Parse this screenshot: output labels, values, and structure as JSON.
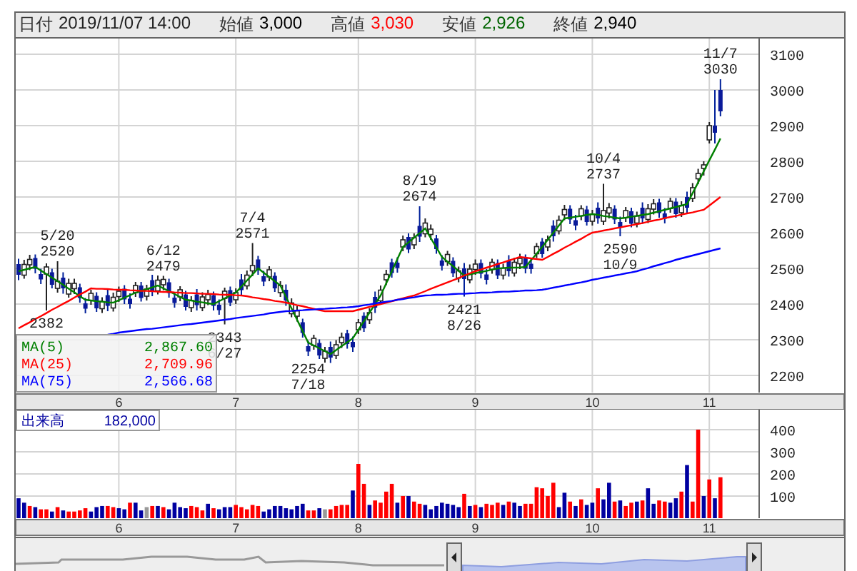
{
  "header": {
    "fields": [
      {
        "label": "日付",
        "value": "2019/11/07 14:00",
        "color": "#222222"
      },
      {
        "label": "始値",
        "value": "3,000",
        "color": "#000000"
      },
      {
        "label": "高値",
        "value": "3,030",
        "color": "#ff0000"
      },
      {
        "label": "安値",
        "value": "2,926",
        "color": "#006400"
      },
      {
        "label": "終値",
        "value": "2,940",
        "color": "#000000"
      }
    ]
  },
  "price_chart": {
    "legend": [
      {
        "value": "2,867.60"
      },
      {
        "value": "2,709.96"
      },
      {
        "value": "2,566.68"
      }
    ],
    "chart_data": {
      "type": "candlestick",
      "grid": true,
      "ylim": [
        2152,
        3144
      ],
      "categories": [
        null,
        null,
        null,
        null,
        null,
        null,
        null,
        null,
        null,
        null,
        null,
        null,
        null,
        null,
        null,
        null,
        null,
        null,
        "6",
        null,
        null,
        null,
        null,
        null,
        null,
        null,
        null,
        null,
        null,
        null,
        null,
        null,
        null,
        null,
        null,
        null,
        null,
        null,
        null,
        "7",
        null,
        null,
        null,
        null,
        null,
        null,
        null,
        null,
        null,
        null,
        null,
        null,
        null,
        null,
        null,
        null,
        null,
        null,
        null,
        null,
        null,
        "8",
        null,
        null,
        null,
        null,
        null,
        null,
        null,
        null,
        null,
        null,
        null,
        null,
        null,
        null,
        null,
        null,
        null,
        null,
        null,
        null,
        "9",
        null,
        null,
        null,
        null,
        null,
        null,
        null,
        null,
        null,
        null,
        null,
        null,
        null,
        null,
        null,
        null,
        null,
        null,
        null,
        null,
        "10",
        null,
        null,
        null,
        null,
        null,
        null,
        null,
        null,
        null,
        null,
        null,
        null,
        null,
        null,
        null,
        null,
        null,
        null,
        null,
        null,
        "11",
        null,
        null
      ],
      "yticks": [
        2200,
        2300,
        2400,
        2500,
        2600,
        2700,
        2800,
        2900,
        3000,
        3100
      ],
      "ohlc": [
        [
          2512,
          2527,
          2467,
          2482
        ],
        [
          2481,
          2524,
          2471,
          2511
        ],
        [
          2510,
          2538,
          2495,
          2525
        ],
        [
          2529,
          2539,
          2486,
          2499
        ],
        [
          2484,
          2499,
          2456,
          2469
        ],
        [
          2484,
          2514,
          2382,
          2504
        ],
        [
          2489,
          2499,
          2444,
          2454
        ],
        [
          2444,
          2520,
          2432,
          2464
        ],
        [
          2474,
          2489,
          2429,
          2444
        ],
        [
          2428,
          2471,
          2418,
          2458
        ],
        [
          2443,
          2471,
          2428,
          2458
        ],
        [
          2447,
          2457,
          2404,
          2417
        ],
        [
          2402,
          2417,
          2374,
          2387
        ],
        [
          2410,
          2440,
          2398,
          2430
        ],
        [
          2423,
          2433,
          2378,
          2388
        ],
        [
          2387,
          2419,
          2375,
          2407
        ],
        [
          2425,
          2440,
          2380,
          2395
        ],
        [
          2389,
          2432,
          2379,
          2419
        ],
        [
          2421,
          2449,
          2406,
          2436
        ],
        [
          2443,
          2453,
          2400,
          2413
        ],
        [
          2415,
          2430,
          2387,
          2400
        ],
        [
          2432,
          2462,
          2420,
          2452
        ],
        [
          2452,
          2462,
          2407,
          2417
        ],
        [
          2422,
          2454,
          2410,
          2442
        ],
        [
          2467,
          2482,
          2422,
          2437
        ],
        [
          2437,
          2480,
          2427,
          2467
        ],
        [
          2454,
          2479,
          2439,
          2469
        ],
        [
          2461,
          2471,
          2418,
          2431
        ],
        [
          2418,
          2433,
          2390,
          2403
        ],
        [
          2420,
          2450,
          2408,
          2440
        ],
        [
          2427,
          2437,
          2382,
          2392
        ],
        [
          2390,
          2422,
          2378,
          2410
        ],
        [
          2427,
          2442,
          2382,
          2397
        ],
        [
          2390,
          2433,
          2380,
          2420
        ],
        [
          2412,
          2440,
          2397,
          2427
        ],
        [
          2425,
          2435,
          2382,
          2395
        ],
        [
          2398,
          2413,
          2370,
          2383
        ],
        [
          2416,
          2446,
          2343,
          2436
        ],
        [
          2439,
          2449,
          2394,
          2404
        ],
        [
          2412,
          2444,
          2400,
          2432
        ],
        [
          2469,
          2484,
          2424,
          2439
        ],
        [
          2451,
          2494,
          2441,
          2481
        ],
        [
          2493,
          2571,
          2478,
          2508
        ],
        [
          2525,
          2535,
          2482,
          2495
        ],
        [
          2478,
          2493,
          2450,
          2463
        ],
        [
          2476,
          2506,
          2464,
          2496
        ],
        [
          2479,
          2489,
          2434,
          2444
        ],
        [
          2432,
          2464,
          2420,
          2452
        ],
        [
          2440,
          2455,
          2395,
          2410
        ],
        [
          2373,
          2416,
          2363,
          2403
        ],
        [
          2366,
          2394,
          2351,
          2381
        ],
        [
          2349,
          2359,
          2306,
          2319
        ],
        [
          2282,
          2297,
          2254,
          2267
        ],
        [
          2284,
          2314,
          2272,
          2304
        ],
        [
          2291,
          2301,
          2246,
          2256
        ],
        [
          2248,
          2280,
          2236,
          2268
        ],
        [
          2280,
          2295,
          2235,
          2250
        ],
        [
          2256,
          2299,
          2246,
          2286
        ],
        [
          2292,
          2320,
          2277,
          2307
        ],
        [
          2318,
          2328,
          2275,
          2288
        ],
        [
          2294,
          2309,
          2266,
          2279
        ],
        [
          2328,
          2358,
          2316,
          2348
        ],
        [
          2367,
          2377,
          2322,
          2332
        ],
        [
          2356,
          2388,
          2344,
          2376
        ],
        [
          2420,
          2435,
          2375,
          2390
        ],
        [
          2409,
          2452,
          2399,
          2439
        ],
        [
          2468,
          2496,
          2453,
          2483
        ],
        [
          2517,
          2527,
          2474,
          2487
        ],
        [
          2516,
          2531,
          2488,
          2501
        ],
        [
          2560,
          2592,
          2548,
          2580
        ],
        [
          2588,
          2598,
          2543,
          2553
        ],
        [
          2566,
          2598,
          2554,
          2586
        ],
        [
          2619,
          2674,
          2574,
          2589
        ],
        [
          2597,
          2640,
          2587,
          2627
        ],
        [
          2595,
          2623,
          2580,
          2610
        ],
        [
          2584,
          2594,
          2541,
          2554
        ],
        [
          2522,
          2537,
          2494,
          2507
        ],
        [
          2519,
          2549,
          2507,
          2539
        ],
        [
          2521,
          2531,
          2476,
          2486
        ],
        [
          2473,
          2505,
          2461,
          2493
        ],
        [
          2500,
          2515,
          2421,
          2470
        ],
        [
          2468,
          2511,
          2458,
          2498
        ],
        [
          2497,
          2525,
          2482,
          2512
        ],
        [
          2515,
          2525,
          2472,
          2485
        ],
        [
          2483,
          2498,
          2455,
          2468
        ],
        [
          2497,
          2527,
          2485,
          2517
        ],
        [
          2515,
          2525,
          2470,
          2480
        ],
        [
          2481,
          2513,
          2469,
          2501
        ],
        [
          2522,
          2537,
          2477,
          2492
        ],
        [
          2487,
          2530,
          2477,
          2517
        ],
        [
          2513,
          2541,
          2498,
          2528
        ],
        [
          2529,
          2539,
          2486,
          2499
        ],
        [
          2513,
          2528,
          2485,
          2498
        ],
        [
          2541,
          2571,
          2529,
          2561
        ],
        [
          2575,
          2585,
          2530,
          2540
        ],
        [
          2560,
          2592,
          2548,
          2580
        ],
        [
          2620,
          2635,
          2575,
          2590
        ],
        [
          2605,
          2648,
          2595,
          2635
        ],
        [
          2650,
          2678,
          2635,
          2665
        ],
        [
          2667,
          2677,
          2624,
          2637
        ],
        [
          2635,
          2650,
          2607,
          2620
        ],
        [
          2647,
          2677,
          2635,
          2667
        ],
        [
          2665,
          2675,
          2620,
          2630
        ],
        [
          2632,
          2664,
          2620,
          2652
        ],
        [
          2670,
          2685,
          2625,
          2640
        ],
        [
          2632,
          2737,
          2622,
          2662
        ],
        [
          2655,
          2683,
          2640,
          2670
        ],
        [
          2667,
          2677,
          2624,
          2637
        ],
        [
          2630,
          2645,
          2590,
          2615
        ],
        [
          2642,
          2672,
          2630,
          2662
        ],
        [
          2660,
          2670,
          2615,
          2625
        ],
        [
          2627,
          2659,
          2615,
          2647
        ],
        [
          2670,
          2685,
          2625,
          2640
        ],
        [
          2637,
          2680,
          2627,
          2667
        ],
        [
          2666,
          2694,
          2651,
          2681
        ],
        [
          2685,
          2695,
          2642,
          2655
        ],
        [
          2654,
          2669,
          2626,
          2639
        ],
        [
          2668,
          2698,
          2656,
          2688
        ],
        [
          2687,
          2697,
          2642,
          2652
        ],
        [
          2656,
          2688,
          2644,
          2676
        ],
        [
          2700,
          2715,
          2655,
          2670
        ],
        [
          2696,
          2739,
          2686,
          2726
        ],
        [
          2751,
          2779,
          2736,
          2766
        ],
        [
          2780,
          2800,
          2760,
          2790
        ],
        [
          2860,
          2910,
          2850,
          2900
        ],
        [
          2900,
          3000,
          2850,
          2880
        ],
        [
          3000,
          3030,
          2926,
          2940
        ]
      ],
      "series": [
        {
          "name": "MA(5)",
          "type": "line",
          "color": "#008000",
          "values": [
            2492,
            2496,
            2500,
            2504,
            2494,
            2484,
            2474,
            2464,
            2454,
            2443,
            2433,
            2422,
            2412,
            2410,
            2408,
            2407,
            2405,
            2404,
            2411,
            2418,
            2425,
            2432,
            2437,
            2442,
            2447,
            2452,
            2444,
            2436,
            2428,
            2420,
            2412,
            2410,
            2407,
            2405,
            2402,
            2400,
            2408,
            2416,
            2424,
            2432,
            2449,
            2466,
            2483,
            2500,
            2488,
            2476,
            2464,
            2452,
            2420,
            2388,
            2356,
            2324,
            2292,
            2284,
            2276,
            2268,
            2260,
            2271,
            2282,
            2293,
            2304,
            2328,
            2352,
            2376,
            2400,
            2424,
            2458,
            2492,
            2526,
            2560,
            2573,
            2586,
            2599,
            2612,
            2585,
            2559,
            2532,
            2519,
            2506,
            2493,
            2480,
            2483,
            2487,
            2490,
            2493,
            2497,
            2500,
            2501,
            2502,
            2502,
            2503,
            2504,
            2523,
            2541,
            2560,
            2580,
            2600,
            2620,
            2640,
            2642,
            2645,
            2647,
            2650,
            2652,
            2650,
            2647,
            2645,
            2642,
            2640,
            2642,
            2645,
            2647,
            2650,
            2652,
            2656,
            2660,
            2664,
            2668,
            2672,
            2676,
            2680,
            2711,
            2741,
            2772,
            2803,
            2833,
            2864
          ]
        },
        {
          "name": "MA(25)",
          "type": "line",
          "color": "#ff0000",
          "values": [
            2332,
            2341,
            2349,
            2358,
            2366,
            2375,
            2384,
            2392,
            2401,
            2409,
            2418,
            2427,
            2435,
            2444,
            2443,
            2443,
            2442,
            2441,
            2440,
            2440,
            2439,
            2438,
            2437,
            2437,
            2436,
            2435,
            2434,
            2434,
            2433,
            2432,
            2431,
            2431,
            2430,
            2429,
            2429,
            2428,
            2427,
            2426,
            2426,
            2425,
            2424,
            2422,
            2419,
            2417,
            2414,
            2412,
            2409,
            2407,
            2404,
            2401,
            2397,
            2394,
            2390,
            2387,
            2383,
            2380,
            2380,
            2380,
            2380,
            2380,
            2380,
            2384,
            2388,
            2392,
            2396,
            2400,
            2404,
            2408,
            2412,
            2416,
            2420,
            2424,
            2430,
            2436,
            2443,
            2449,
            2455,
            2461,
            2467,
            2473,
            2480,
            2486,
            2492,
            2497,
            2502,
            2507,
            2512,
            2517,
            2522,
            2527,
            2532,
            2530,
            2528,
            2526,
            2524,
            2532,
            2541,
            2549,
            2558,
            2566,
            2575,
            2583,
            2592,
            2600,
            2603,
            2606,
            2609,
            2612,
            2615,
            2618,
            2621,
            2624,
            2627,
            2631,
            2634,
            2637,
            2641,
            2644,
            2647,
            2651,
            2654,
            2657,
            2661,
            2664,
            2676,
            2688,
            2700
          ]
        },
        {
          "name": "MA(75)",
          "type": "line",
          "color": "#0000ff",
          "values": [
            null,
            null,
            null,
            null,
            null,
            null,
            null,
            null,
            null,
            null,
            null,
            null,
            null,
            null,
            null,
            null,
            2314,
            2317,
            2320,
            2322,
            2324,
            2326,
            2328,
            2330,
            2331,
            2333,
            2335,
            2337,
            2339,
            2341,
            2343,
            2344,
            2346,
            2348,
            2350,
            2352,
            2354,
            2356,
            2358,
            2361,
            2363,
            2365,
            2367,
            2369,
            2371,
            2374,
            2376,
            2378,
            2380,
            2381,
            2382,
            2383,
            2384,
            2385,
            2386,
            2387,
            2388,
            2389,
            2390,
            2391,
            2392,
            2394,
            2397,
            2399,
            2402,
            2404,
            2407,
            2409,
            2412,
            2414,
            2417,
            2419,
            2422,
            2424,
            2425,
            2426,
            2426,
            2427,
            2428,
            2429,
            2429,
            2430,
            2431,
            2432,
            2432,
            2433,
            2434,
            2435,
            2435,
            2436,
            2437,
            2438,
            2438,
            2439,
            2440,
            2443,
            2446,
            2449,
            2452,
            2455,
            2458,
            2461,
            2464,
            2468,
            2471,
            2474,
            2477,
            2480,
            2483,
            2486,
            2489,
            2492,
            2497,
            2501,
            2506,
            2510,
            2515,
            2519,
            2524,
            2528,
            2532,
            2536,
            2540,
            2544,
            2548,
            2552,
            2556
          ]
        }
      ],
      "annotations": [
        {
          "y": 2520,
          "text": "5/20"
        },
        {
          "y": 2520,
          "text": "2520"
        },
        {
          "y": 2479,
          "text": "6/12"
        },
        {
          "y": 2479,
          "text": "2479"
        },
        {
          "y": 2571,
          "text": "7/4"
        },
        {
          "y": 2571,
          "text": "2571"
        },
        {
          "y": 2674,
          "text": "8/19"
        },
        {
          "y": 2674,
          "text": "2674"
        },
        {
          "y": 2737,
          "text": "10/4"
        },
        {
          "y": 2737,
          "text": "2737"
        },
        {
          "y": 3030,
          "text": "11/7"
        },
        {
          "y": 3030,
          "text": "3030"
        },
        {
          "y": 2382,
          "text": "2382"
        },
        {
          "y": 2343,
          "text": "2343"
        },
        {
          "y": 2343,
          "text": "6/27"
        },
        {
          "y": 2254,
          "text": "2254"
        },
        {
          "y": 2254,
          "text": "7/18"
        },
        {
          "y": 2421,
          "text": "2421"
        },
        {
          "y": 2421,
          "text": "8/26"
        },
        {
          "y": 2590,
          "text": "2590"
        },
        {
          "y": 2590,
          "text": "10/9"
        }
      ]
    }
  },
  "volume_chart": {
    "label": "出来高",
    "value": "182,000",
    "chart_data": {
      "type": "bar",
      "grid": true,
      "ylim": [
        0,
        490
      ],
      "categories": [
        null,
        null,
        null,
        null,
        null,
        null,
        null,
        null,
        null,
        null,
        null,
        null,
        null,
        null,
        null,
        null,
        null,
        null,
        "6",
        null,
        null,
        null,
        null,
        null,
        null,
        null,
        null,
        null,
        null,
        null,
        null,
        null,
        null,
        null,
        null,
        null,
        null,
        null,
        null,
        "7",
        null,
        null,
        null,
        null,
        null,
        null,
        null,
        null,
        null,
        null,
        null,
        null,
        null,
        null,
        null,
        null,
        null,
        null,
        null,
        null,
        null,
        "8",
        null,
        null,
        null,
        null,
        null,
        null,
        null,
        null,
        null,
        null,
        null,
        null,
        null,
        null,
        null,
        null,
        null,
        null,
        null,
        null,
        "9",
        null,
        null,
        null,
        null,
        null,
        null,
        null,
        null,
        null,
        null,
        null,
        null,
        null,
        null,
        null,
        null,
        null,
        null,
        null,
        null,
        "10",
        null,
        null,
        null,
        null,
        null,
        null,
        null,
        null,
        null,
        null,
        null,
        null,
        null,
        null,
        null,
        null,
        null,
        null,
        null,
        null,
        "11",
        null,
        null
      ],
      "yticks": [
        100,
        200,
        300,
        400
      ],
      "series": [
        {
          "color": "#ff0000",
          "values": [
            null,
            null,
            55,
            null,
            40,
            40,
            null,
            50,
            null,
            30,
            30,
            35,
            45,
            null,
            null,
            null,
            55,
            50,
            null,
            null,
            70,
            null,
            null,
            null,
            55,
            null,
            50,
            null,
            null,
            null,
            null,
            55,
            50,
            35,
            null,
            45,
            null,
            null,
            null,
            60,
            50,
            40,
            60,
            55,
            null,
            null,
            null,
            null,
            null,
            null,
            null,
            null,
            35,
            35,
            null,
            null,
            40,
            55,
            60,
            60,
            null,
            245,
            155,
            null,
            80,
            70,
            120,
            155,
            null,
            100,
            null,
            75,
            65,
            null,
            null,
            null,
            null,
            null,
            null,
            null,
            110,
            null,
            60,
            null,
            65,
            60,
            70,
            null,
            75,
            null,
            null,
            65,
            65,
            140,
            135,
            100,
            160,
            null,
            null,
            75,
            null,
            85,
            null,
            null,
            135,
            null,
            null,
            75,
            null,
            55,
            70,
            null,
            80,
            null,
            null,
            80,
            75,
            null,
            null,
            120,
            null,
            75,
            400,
            null,
            175,
            null,
            185
          ]
        },
        {
          "color": "#0000a0",
          "values": [
            90,
            70,
            null,
            50,
            null,
            null,
            30,
            null,
            35,
            null,
            null,
            null,
            null,
            30,
            50,
            55,
            null,
            null,
            45,
            40,
            null,
            70,
            35,
            null,
            null,
            55,
            null,
            40,
            70,
            50,
            45,
            null,
            null,
            null,
            65,
            null,
            40,
            50,
            50,
            null,
            null,
            null,
            null,
            null,
            30,
            40,
            55,
            55,
            45,
            40,
            55,
            65,
            null,
            null,
            45,
            null,
            null,
            null,
            null,
            null,
            125,
            null,
            null,
            60,
            null,
            null,
            null,
            null,
            70,
            null,
            100,
            null,
            null,
            60,
            40,
            55,
            70,
            65,
            60,
            50,
            null,
            55,
            null,
            50,
            null,
            null,
            null,
            60,
            null,
            70,
            55,
            null,
            null,
            null,
            null,
            null,
            null,
            50,
            115,
            null,
            55,
            null,
            60,
            70,
            null,
            85,
            160,
            null,
            80,
            null,
            null,
            75,
            null,
            135,
            65,
            null,
            null,
            70,
            90,
            null,
            240,
            null,
            null,
            100,
            null,
            90,
            null
          ]
        },
        {
          "color": "#999999",
          "values": [
            null,
            null,
            null,
            null,
            null,
            null,
            null,
            null,
            null,
            null,
            null,
            null,
            null,
            null,
            null,
            null,
            null,
            null,
            null,
            null,
            null,
            null,
            null,
            50,
            null,
            null,
            null,
            null,
            null,
            null,
            null,
            null,
            null,
            null,
            null,
            null,
            null,
            null,
            null,
            null,
            null,
            null,
            null,
            null,
            null,
            null,
            null,
            null,
            null,
            null,
            null,
            null,
            null,
            null,
            null,
            40,
            null,
            null,
            null,
            null,
            null,
            null,
            null,
            null,
            null,
            null,
            null,
            null,
            null,
            null,
            null,
            null,
            null,
            null,
            null,
            null,
            null,
            null,
            null,
            null,
            null,
            null,
            null,
            null,
            null,
            null,
            null,
            null,
            null,
            null,
            null,
            null,
            null,
            null,
            null,
            null,
            null,
            null,
            null,
            null,
            null,
            null,
            null,
            null,
            null,
            null,
            null,
            null,
            null,
            null,
            null,
            null,
            null,
            null,
            null,
            null,
            null,
            null,
            null,
            null,
            null,
            null,
            null,
            null,
            null,
            null,
            null
          ]
        }
      ]
    }
  }
}
